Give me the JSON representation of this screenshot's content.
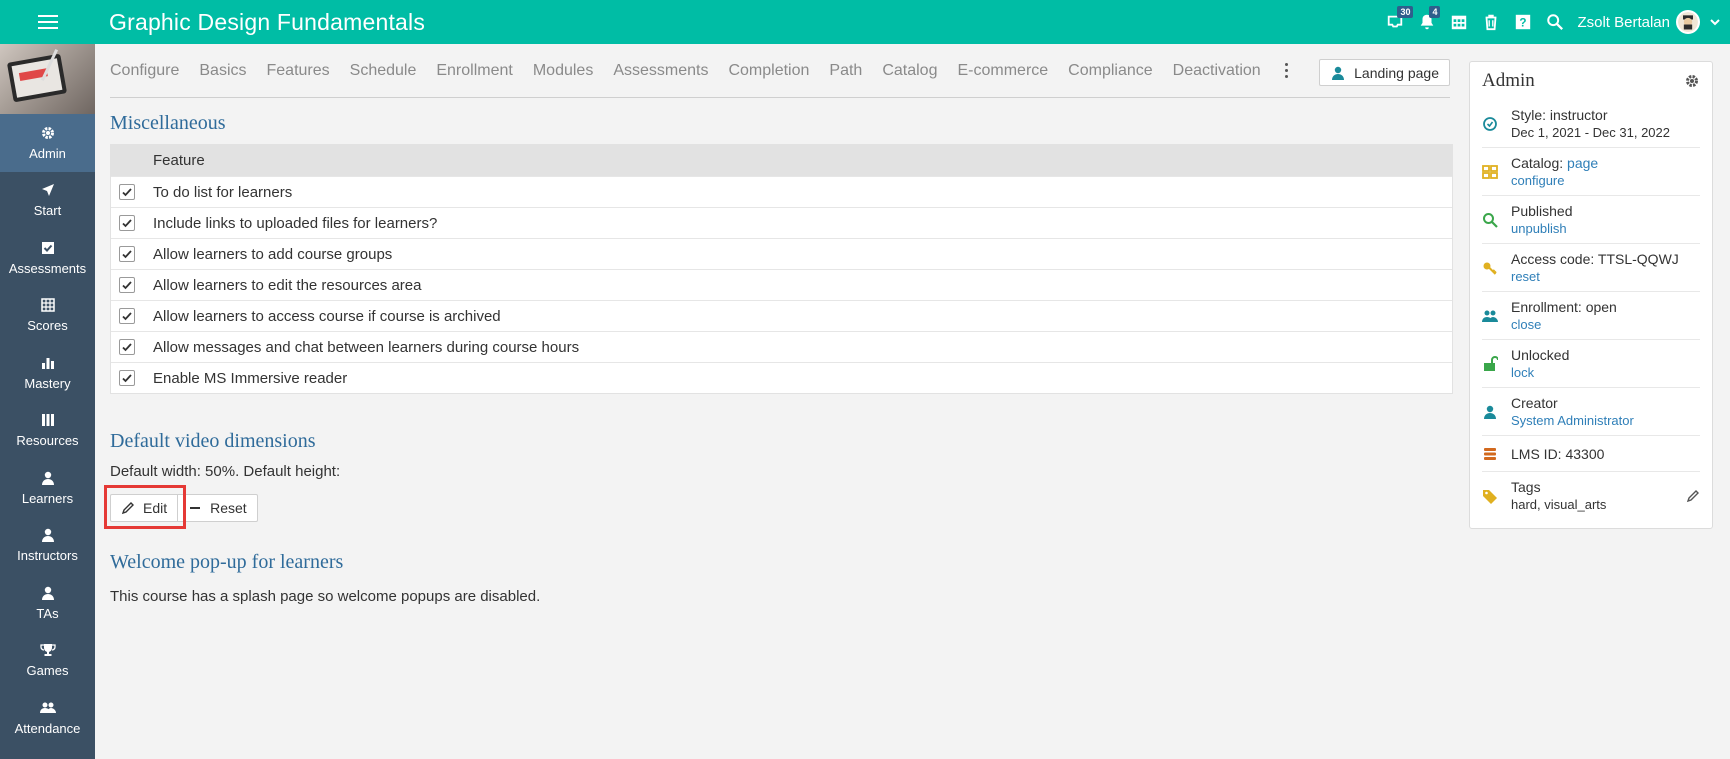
{
  "app": {
    "title": "Graphic Design Fundamentals",
    "user_name": "Zsolt Bertalan",
    "badges": {
      "messages": "30",
      "notifications": "4"
    }
  },
  "icons": {
    "menu": "hamburger-icon",
    "messages": "inbox-icon",
    "notifications": "bell-icon",
    "calendar": "calendar-icon",
    "trash": "trash-icon",
    "help": "help-icon",
    "search": "search-icon"
  },
  "colors": {
    "topbar": "#00bda5",
    "sidebar": "#3b5064",
    "sidebar_active": "#4a6c8c",
    "link": "#2f7fb8",
    "section_title": "#2f6b9a",
    "highlight": "#e53935"
  },
  "sidebar": {
    "items": [
      {
        "label": "Admin",
        "icon": "gear-icon",
        "active": true
      },
      {
        "label": "Start",
        "icon": "arrow-icon"
      },
      {
        "label": "Assessments",
        "icon": "checkbox-icon"
      },
      {
        "label": "Scores",
        "icon": "table-icon"
      },
      {
        "label": "Mastery",
        "icon": "bar-chart-icon"
      },
      {
        "label": "Resources",
        "icon": "books-icon"
      },
      {
        "label": "Learners",
        "icon": "person-icon"
      },
      {
        "label": "Instructors",
        "icon": "person-icon"
      },
      {
        "label": "TAs",
        "icon": "person-icon"
      },
      {
        "label": "Games",
        "icon": "trophy-icon"
      },
      {
        "label": "Attendance",
        "icon": "group-icon"
      }
    ]
  },
  "tabs": [
    "Configure",
    "Basics",
    "Features",
    "Schedule",
    "Enrollment",
    "Modules",
    "Assessments",
    "Completion",
    "Path",
    "Catalog",
    "E-commerce",
    "Compliance",
    "Deactivation"
  ],
  "landing_page_label": "Landing page",
  "misc": {
    "title": "Miscellaneous",
    "header": "Feature",
    "rows": [
      {
        "label": "To do list for learners",
        "checked": true
      },
      {
        "label": "Include links to uploaded files for learners?",
        "checked": true
      },
      {
        "label": "Allow learners to add course groups",
        "checked": true
      },
      {
        "label": "Allow learners to edit the resources area",
        "checked": true
      },
      {
        "label": "Allow learners to access course if course is archived",
        "checked": true
      },
      {
        "label": "Allow messages and chat between learners during course hours",
        "checked": true
      },
      {
        "label": "Enable MS Immersive reader",
        "checked": true
      }
    ]
  },
  "video": {
    "title": "Default video dimensions",
    "text": "Default width: 50%. Default height:",
    "edit_label": "Edit",
    "reset_label": "Reset"
  },
  "welcome": {
    "title": "Welcome pop-up for learners",
    "text": "This course has a splash page so welcome popups are disabled."
  },
  "admin_panel": {
    "title": "Admin",
    "style": {
      "label": "Style: instructor",
      "dates": "Dec 1, 2021 - Dec 31, 2022"
    },
    "catalog": {
      "label": "Catalog:",
      "link": "page",
      "sub": "configure"
    },
    "published": {
      "label": "Published",
      "sub": "unpublish"
    },
    "access": {
      "label": "Access code: TTSL-QQWJ",
      "sub": "reset"
    },
    "enrollment": {
      "label": "Enrollment: open",
      "sub": "close"
    },
    "unlocked": {
      "label": "Unlocked",
      "sub": "lock"
    },
    "creator": {
      "label": "Creator",
      "sub": "System Administrator"
    },
    "lms": {
      "label": "LMS ID: 43300"
    },
    "tags": {
      "label": "Tags",
      "sub": "hard, visual_arts"
    }
  }
}
